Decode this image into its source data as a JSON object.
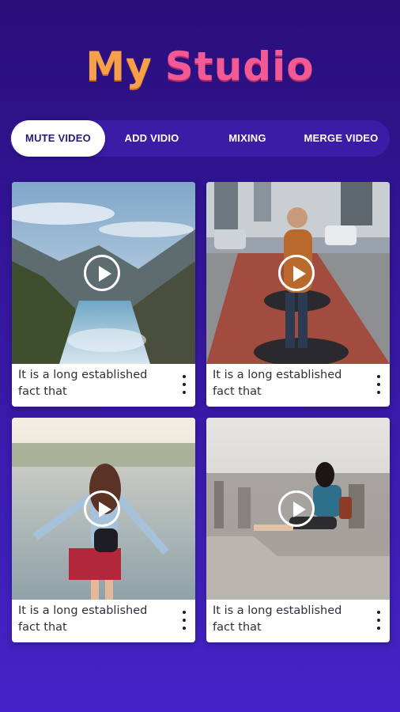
{
  "header": {
    "title_word1": "My",
    "title_word2": "Studio"
  },
  "colors": {
    "title_word1": "#f6a04a",
    "title_word2": "#f25a96",
    "background": "#3517a0"
  },
  "tabs": [
    {
      "label": "MUTE VIDEO",
      "active": true
    },
    {
      "label": "ADD VIDIO",
      "active": false
    },
    {
      "label": "MIXING",
      "active": false
    },
    {
      "label": "MERGE VIDEO",
      "active": false
    }
  ],
  "videos": [
    {
      "caption": "It is a long established fact that",
      "icon": "play-icon"
    },
    {
      "caption": "It is a long established fact that",
      "icon": "play-icon"
    },
    {
      "caption": "It is a long established fact that",
      "icon": "play-icon"
    },
    {
      "caption": "It is a long established fact that",
      "icon": "play-icon"
    }
  ]
}
